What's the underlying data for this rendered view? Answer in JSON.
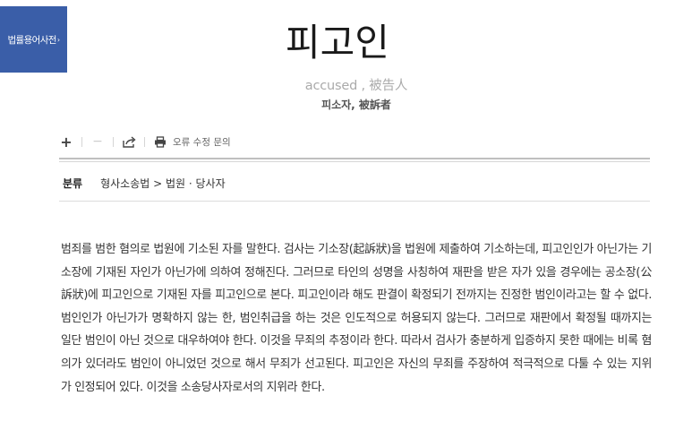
{
  "badge": {
    "label": "법률용어사전",
    "arrow": "›"
  },
  "entry": {
    "title": "피고인",
    "subtitle": "accused , 被告人",
    "synonyms": "피소자, 被訴者"
  },
  "toolbar": {
    "plus_icon": "+",
    "minus_icon": "−",
    "share_icon": "share-icon",
    "print_icon": "print-icon",
    "report_label": "오류 수정 문의"
  },
  "category": {
    "label": "분류",
    "value": "형사소송법 > 법원 · 당사자"
  },
  "body": "범죄를 범한 혐의로 법원에 기소된 자를 말한다. 검사는 기소장(起訴狀)을 법원에 제출하여 기소하는데, 피고인인가 아닌가는 기소장에 기재된 자인가 아닌가에 의하여 정해진다. 그러므로 타인의 성명을 사칭하여 재판을 받은 자가 있을 경우에는 공소장(公訴狀)에 피고인으로 기재된 자를 피고인으로 본다. 피고인이라 해도 판결이 확정되기 전까지는 진정한 범인이라고는 할 수 없다. 범인인가 아닌가가 명확하지 않는 한, 범인취급을 하는 것은 인도적으로 허용되지 않는다. 그러므로 재판에서 확정될 때까지는 일단 범인이 아닌 것으로 대우하여야 한다. 이것을 무죄의 추정이라 한다. 따라서 검사가 충분하게 입증하지 못한 때에는 비록 혐의가 있더라도 범인이 아니었던 것으로 해서 무죄가 선고된다. 피고인은 자신의 무죄를 주장하여 적극적으로 다툴 수 있는 지위가 인정되어 있다. 이것을 소송당사자로서의 지위라 한다.",
  "colors": {
    "badge_bg": "#3a5ea8",
    "title": "#1a1a1a",
    "subtitle": "#aaaaaa"
  }
}
